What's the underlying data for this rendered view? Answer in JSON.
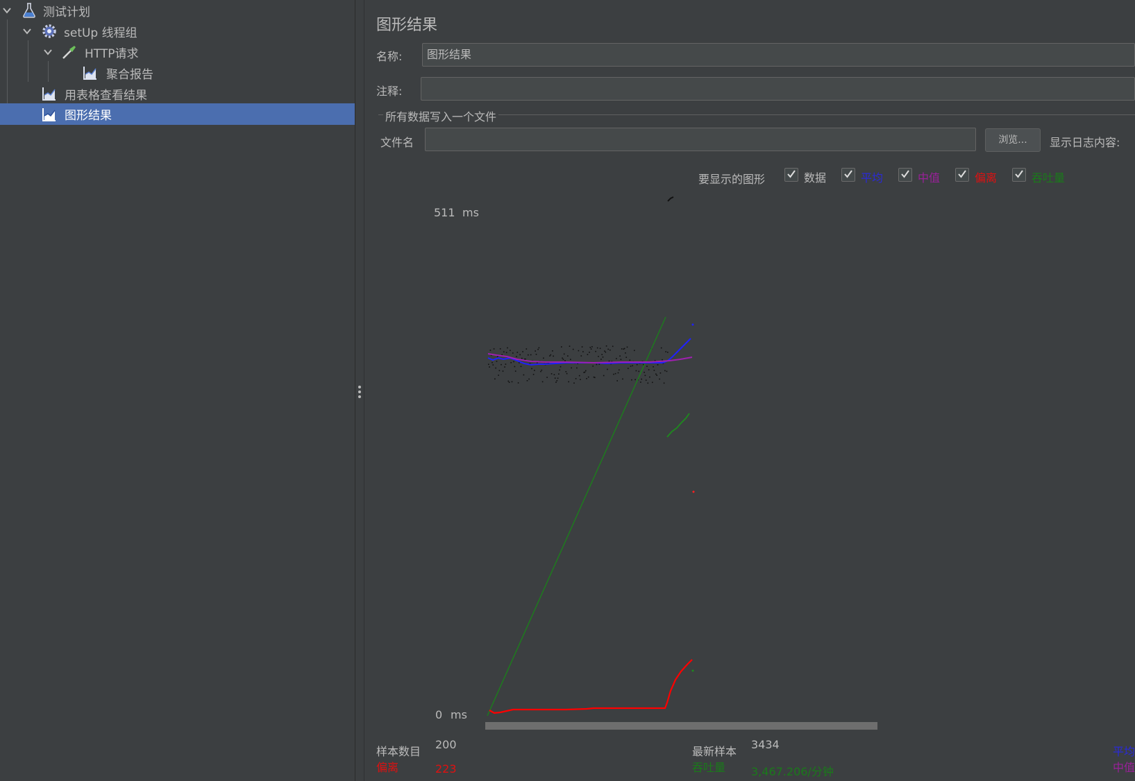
{
  "tree": {
    "items": [
      {
        "label": "测试计划",
        "icon": "flask-icon"
      },
      {
        "label": "setUp 线程组",
        "icon": "gear-icon"
      },
      {
        "label": "HTTP请求",
        "icon": "pipette-icon"
      },
      {
        "label": "聚合报告",
        "icon": "graph-report-icon"
      },
      {
        "label": "用表格查看结果",
        "icon": "graph-report-icon"
      },
      {
        "label": "图形结果",
        "icon": "graph-report-icon"
      }
    ]
  },
  "panel": {
    "title": "图形结果",
    "name_label": "名称:",
    "name_value": "图形结果",
    "comment_label": "注释:",
    "comment_value": "",
    "file_section_title": "所有数据写入一个文件",
    "filename_label": "文件名",
    "filename_value": "",
    "browse_button": "浏览...",
    "log_label": "显示日志内容:"
  },
  "graph_options": {
    "label": "要显示的图形",
    "options": [
      {
        "label": "数据",
        "checked": true,
        "color": "#bbbbbb"
      },
      {
        "label": "平均",
        "checked": true,
        "color": "#0000ff"
      },
      {
        "label": "中值",
        "checked": true,
        "color": "#800080"
      },
      {
        "label": "偏离",
        "checked": true,
        "color": "#ff0000"
      },
      {
        "label": "吞吐量",
        "checked": true,
        "color": "#008000"
      }
    ]
  },
  "chart": {
    "y_max_value": "511",
    "y_max_unit": "ms",
    "y_min_value": "0",
    "y_min_unit": "ms"
  },
  "stats": {
    "sample_count_label": "样本数目",
    "sample_count_value": "200",
    "deviation_label": "偏离",
    "deviation_value": "223",
    "latest_sample_label": "最新样本",
    "latest_sample_value": "3434",
    "throughput_label": "吞吐量",
    "throughput_value": "3,467.206/分钟",
    "average_label": "平均",
    "median_label": "中值"
  },
  "colors": {
    "data": "#111111",
    "average": "#0000ff",
    "median": "#9a209a",
    "deviation": "#ff0000",
    "throughput": "#008000",
    "selection": "#4b6eaf",
    "background": "#3c3f41"
  }
}
